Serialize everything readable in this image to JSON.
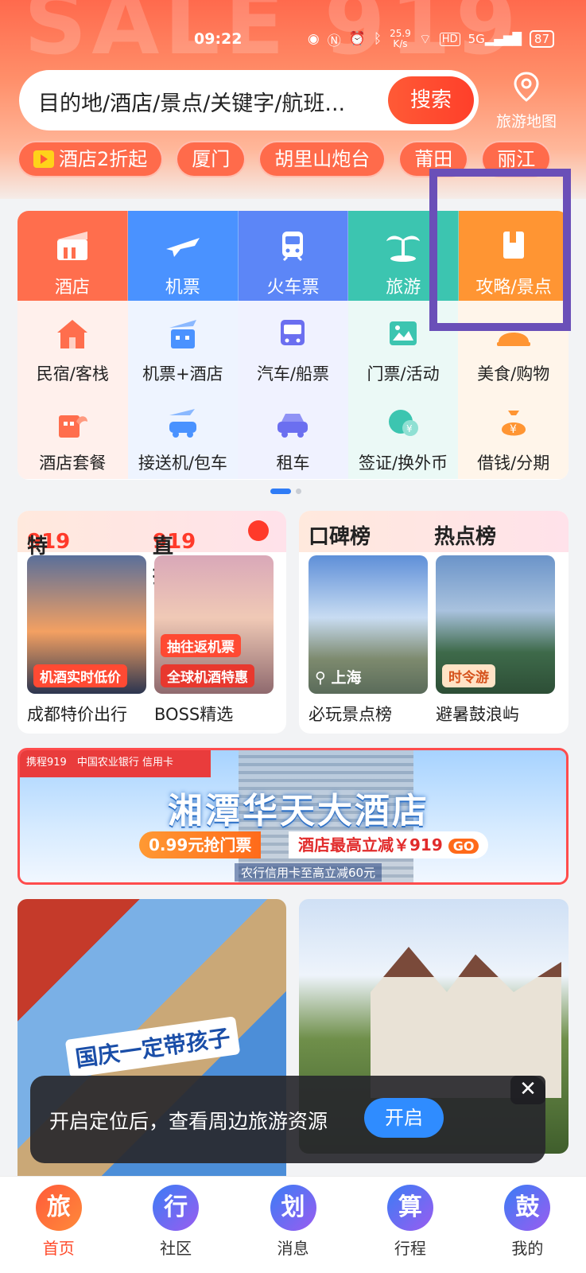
{
  "status_bar": {
    "time": "09:22",
    "speed_top": "25.9",
    "speed_unit": "K/s",
    "hd": "HD",
    "signal": "5G",
    "battery": "87"
  },
  "search": {
    "placeholder": "目的地/酒店/景点/关键字/航班...",
    "button": "搜索"
  },
  "map_button": {
    "label": "旅游地图"
  },
  "chips": [
    "酒店2折起",
    "厦门",
    "胡里山炮台",
    "莆田",
    "丽江"
  ],
  "main_categories": [
    {
      "label": "酒店",
      "icon": "hotel-icon"
    },
    {
      "label": "机票",
      "icon": "plane-icon"
    },
    {
      "label": "火车票",
      "icon": "train-icon"
    },
    {
      "label": "旅游",
      "icon": "palm-tree-icon"
    },
    {
      "label": "攻略/景点",
      "icon": "guidebook-icon"
    }
  ],
  "sub_categories_row1": [
    {
      "label": "民宿/客栈",
      "icon": "house-icon"
    },
    {
      "label": "机票+酒店",
      "icon": "flight-hotel-icon"
    },
    {
      "label": "汽车/船票",
      "icon": "bus-icon"
    },
    {
      "label": "门票/活动",
      "icon": "ticket-icon"
    },
    {
      "label": "美食/购物",
      "icon": "food-icon"
    }
  ],
  "sub_categories_row2": [
    {
      "label": "酒店套餐",
      "icon": "hotel-package-icon"
    },
    {
      "label": "接送机/包车",
      "icon": "pickup-car-icon"
    },
    {
      "label": "租车",
      "icon": "car-icon"
    },
    {
      "label": "签证/换外币",
      "icon": "visa-icon"
    },
    {
      "label": "借钱/分期",
      "icon": "money-bag-icon"
    }
  ],
  "promo_left": {
    "title_a_num": "919",
    "title_a": "特价",
    "title_b_num": "919",
    "title_b": "直播",
    "tile1_tag": "机酒实时低价",
    "tile1_caption": "成都特价出行",
    "tile2_top_tag": "抽往返机票",
    "tile2_tag": "全球机酒特惠",
    "tile2_caption": "BOSS精选"
  },
  "promo_right": {
    "title_a": "口碑榜",
    "title_b": "热点榜",
    "tile1_loc": "上海",
    "tile1_caption": "必玩景点榜",
    "tile2_tag": "时令游",
    "tile2_caption": "避暑鼓浪屿"
  },
  "banner": {
    "top_left": "携程919",
    "bank": "中国农业银行 信用卡",
    "title": "湘潭华天大酒店",
    "pill1": "0.99元抢门票",
    "pill2": "酒店最高立减￥919",
    "go": "GO",
    "foot": "农行信用卡至高立减60元"
  },
  "feed": {
    "slogan": "国庆一定带孩子"
  },
  "toast": {
    "message": "开启定位后，查看周边旅游资源",
    "button": "开启",
    "close": "✕"
  },
  "tabbar": [
    {
      "badge": "旅",
      "label": "首页"
    },
    {
      "badge": "行",
      "label": "社区"
    },
    {
      "badge": "划",
      "label": "消息"
    },
    {
      "badge": "算",
      "label": "行程"
    },
    {
      "badge": "鼓",
      "label": "我的"
    }
  ],
  "colors": {
    "accent": "#ff4a2a",
    "highlight_box": "#6a4fb8"
  }
}
